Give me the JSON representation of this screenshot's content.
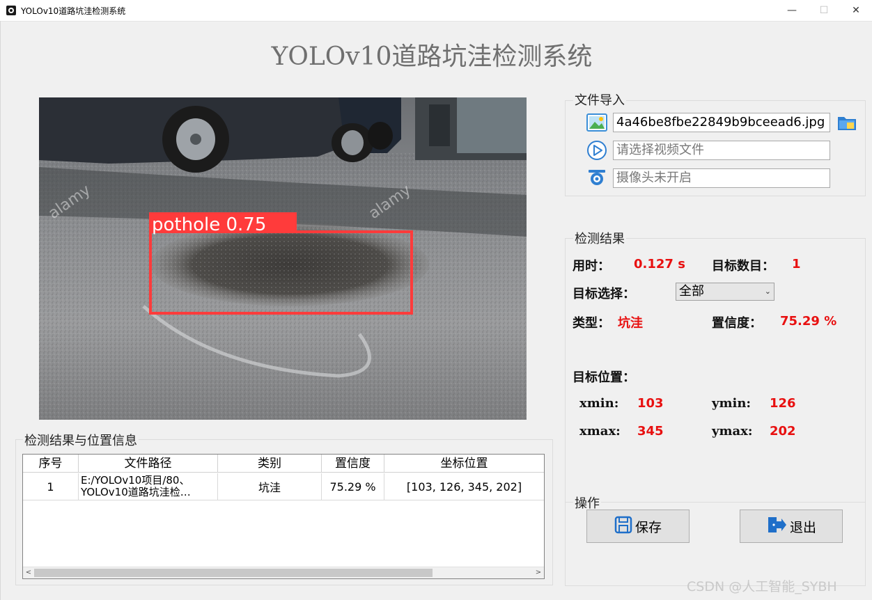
{
  "window": {
    "title": "YOLOv10道路坑洼检测系统",
    "controls": {
      "minimize": "—",
      "maximize": "☐",
      "close": "✕"
    }
  },
  "header": {
    "title": "YOLOv10道路坑洼检测系统"
  },
  "image_view": {
    "detection_label": "pothole 0.75",
    "watermark_text": "alamy",
    "box_color": "#ff3b3b"
  },
  "file_import": {
    "title": "文件导入",
    "image_file_value": "4a46be8fbe22849b9bceead6.jpg",
    "video_placeholder": "请选择视频文件",
    "camera_placeholder": "摄像头未开启",
    "icons": [
      "image-icon",
      "video-play-icon",
      "camera-icon",
      "folder-icon"
    ]
  },
  "results": {
    "title": "检测结果",
    "time_label": "用时：",
    "time_value": "0.127 s",
    "count_label": "目标数目：",
    "count_value": "1",
    "select_label": "目标选择：",
    "select_value": "全部",
    "type_label": "类型：",
    "type_value": "坑洼",
    "conf_label": "置信度：",
    "conf_value": "75.29 %",
    "position_label": "目标位置：",
    "xmin_label": "xmin:",
    "xmin_value": "103",
    "ymin_label": "ymin:",
    "ymin_value": "126",
    "xmax_label": "xmax:",
    "xmax_value": "345",
    "ymax_label": "ymax:",
    "ymax_value": "202",
    "accent_color": "#e81010"
  },
  "actions": {
    "title": "操作",
    "save_label": "保存",
    "exit_label": "退出"
  },
  "table": {
    "title": "检测结果与位置信息",
    "headers": [
      "序号",
      "文件路径",
      "类别",
      "置信度",
      "坐标位置"
    ],
    "rows": [
      {
        "index": "1",
        "path_line1": "E:/YOLOv10项目/80、",
        "path_line2": "YOLOv10道路坑洼检…",
        "category": "坑洼",
        "confidence": "75.29 %",
        "coords": "[103, 126, 345, 202]"
      }
    ],
    "scroll_left": "<",
    "scroll_right": ">"
  },
  "watermark": "CSDN @人工智能_SYBH"
}
